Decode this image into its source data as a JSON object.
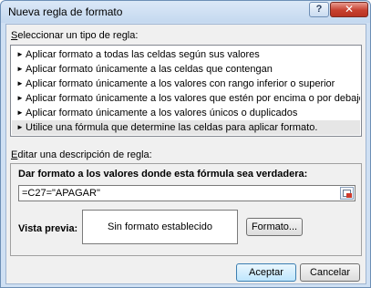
{
  "window": {
    "title": "Nueva regla de formato",
    "help_label": "?",
    "close_label": "✕"
  },
  "rule_type": {
    "label_prefix": "S",
    "label_rest": "eleccionar un tipo de regla:",
    "items": [
      {
        "label": "Aplicar formato a todas las celdas según sus valores"
      },
      {
        "label": "Aplicar formato únicamente a las celdas que contengan"
      },
      {
        "label": "Aplicar formato únicamente a los valores con rango inferior o superior"
      },
      {
        "label": "Aplicar formato únicamente a los valores que estén por encima o por debajo del promedio"
      },
      {
        "label": "Aplicar formato únicamente a los valores únicos o duplicados"
      },
      {
        "label": "Utilice una fórmula que determine las celdas para aplicar formato.",
        "selected": true
      }
    ]
  },
  "description": {
    "label_prefix": "E",
    "label_rest": "ditar una descripción de regla:",
    "formula_title": "Dar formato a los valores donde esta fórmula sea verdadera:",
    "formula_value": "=C27=\"APAGAR\"",
    "preview_label": "Vista previa:",
    "preview_text": "Sin formato establecido",
    "format_button": "Formato..."
  },
  "buttons": {
    "ok": "Aceptar",
    "cancel": "Cancelar"
  }
}
